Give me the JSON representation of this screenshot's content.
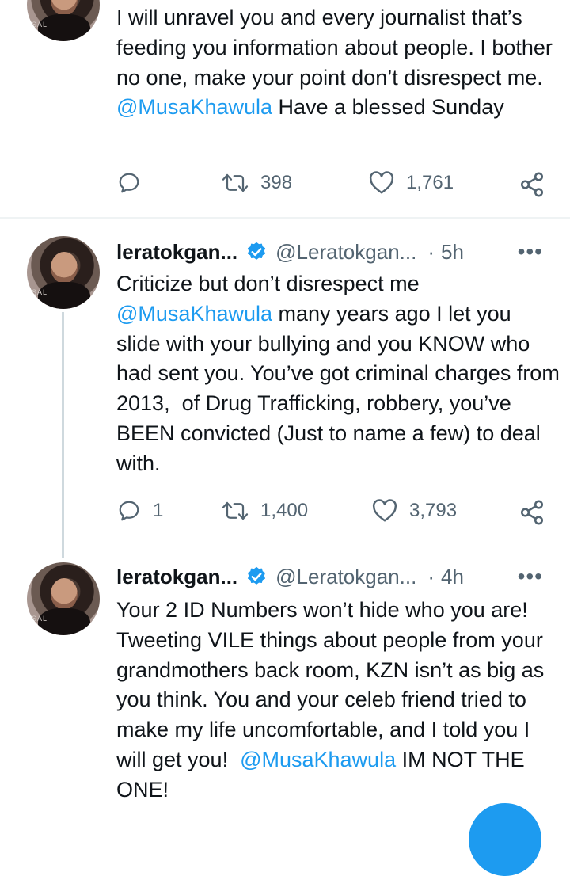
{
  "tweets": [
    {
      "text_parts": [
        "I will unravel you and every journalist that’s feeding you information about people. I bother no one, make your point don’t disrespect me. ",
        "@MusaKhawula",
        " Have a blessed Sunday"
      ],
      "replies": "",
      "retweets": "398",
      "likes": "1,761"
    },
    {
      "name": "leratokgan...",
      "handle": "@Leratokgan...",
      "time": "5h",
      "text_parts": [
        "Criticize but don’t disrespect me ",
        "@MusaKhawula",
        " many years ago I let you slide with your bullying and you KNOW who had sent you. You’ve got criminal charges from 2013,  of Drug Trafficking, robbery, you’ve BEEN convicted (Just to name a few) to deal with."
      ],
      "replies": "1",
      "retweets": "1,400",
      "likes": "3,793"
    },
    {
      "name": "leratokgan...",
      "handle": "@Leratokgan...",
      "time": "4h",
      "text_parts": [
        "Your 2 ID Numbers won’t hide who you are! Tweeting VILE things about people from your grandmothers back room, KZN isn’t as big as you think. You and your celeb friend tried to make my life uncomfortable, and I told you I will get you!  ",
        "@MusaKhawula",
        " IM NOT THE ONE!"
      ]
    }
  ],
  "avatar_watermark": "SAL",
  "more_glyph": "•••",
  "dot_sep": "·",
  "colors": {
    "accent": "#1d9bf0",
    "muted": "#536471",
    "text": "#0f1419"
  }
}
